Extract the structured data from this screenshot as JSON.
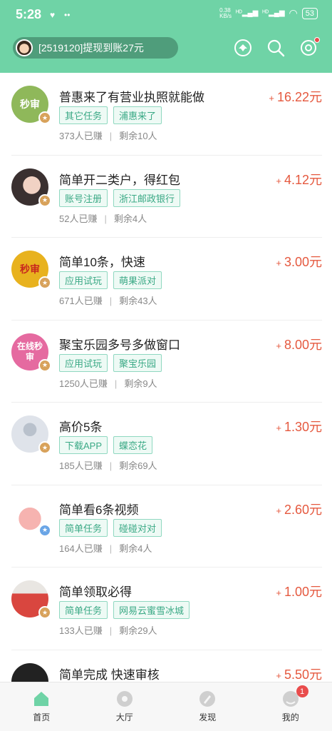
{
  "status_bar": {
    "time": "5:28",
    "network_speed": "0.38\nKB/s",
    "battery": "53"
  },
  "header": {
    "notice_text": "[2519120]提现到账27元",
    "icons": [
      "inbox-icon",
      "search-icon",
      "settings-icon"
    ]
  },
  "tasks": [
    {
      "title": "普惠来了有营业执照就能做",
      "price": "16.22元",
      "tags": [
        "其它任务",
        "浦惠来了"
      ],
      "earned": "373人已赚",
      "remaining": "剩余10人",
      "thumb_text": "秒审",
      "thumb_color": "#8fb85a"
    },
    {
      "title": "简单开二类户，得红包",
      "price": "4.12元",
      "tags": [
        "账号注册",
        "浙江邮政银行"
      ],
      "earned": "52人已赚",
      "remaining": "剩余4人",
      "thumb_text": "",
      "thumb_color": "#3a3030"
    },
    {
      "title": "简单10条，快速",
      "price": "3.00元",
      "tags": [
        "应用试玩",
        "萌果派对"
      ],
      "earned": "671人已赚",
      "remaining": "剩余43人",
      "thumb_text": "秒审",
      "thumb_color": "#e8b21e"
    },
    {
      "title": "聚宝乐园多号多做窗口",
      "price": "8.00元",
      "tags": [
        "应用试玩",
        "聚宝乐园"
      ],
      "earned": "1250人已赚",
      "remaining": "剩余9人",
      "thumb_text": "在线秒审",
      "thumb_color": "#e56aa0"
    },
    {
      "title": "高价5条",
      "price": "1.30元",
      "tags": [
        "下载APP",
        "蝶恋花"
      ],
      "earned": "185人已赚",
      "remaining": "剩余69人",
      "thumb_text": "",
      "thumb_color": "#dfe3ea"
    },
    {
      "title": "简单看6条视频",
      "price": "2.60元",
      "tags": [
        "简单任务",
        "碰碰对对"
      ],
      "earned": "164人已赚",
      "remaining": "剩余4人",
      "thumb_text": "",
      "thumb_color": "#f3c6c0"
    },
    {
      "title": "简单领取必得",
      "price": "1.00元",
      "tags": [
        "简单任务",
        "网易云蜜雪冰城"
      ],
      "earned": "133人已赚",
      "remaining": "剩余29人",
      "thumb_text": "",
      "thumb_color": "#d9463f"
    },
    {
      "title": "简单完成 快速审核",
      "price": "5.50元",
      "tags": [],
      "earned": "",
      "remaining": "",
      "thumb_text": "",
      "thumb_color": "#222222"
    }
  ],
  "bottom_nav": [
    {
      "label": "首页",
      "icon": "home-icon",
      "active": true
    },
    {
      "label": "大厅",
      "icon": "hall-icon",
      "active": false
    },
    {
      "label": "发现",
      "icon": "discover-icon",
      "active": false
    },
    {
      "label": "我的",
      "icon": "profile-icon",
      "active": false,
      "badge": "1"
    }
  ],
  "colors": {
    "brand": "#6fd3a6",
    "price": "#e5593f",
    "tag_border": "#8fd8c0",
    "tag_text": "#3aa985"
  }
}
